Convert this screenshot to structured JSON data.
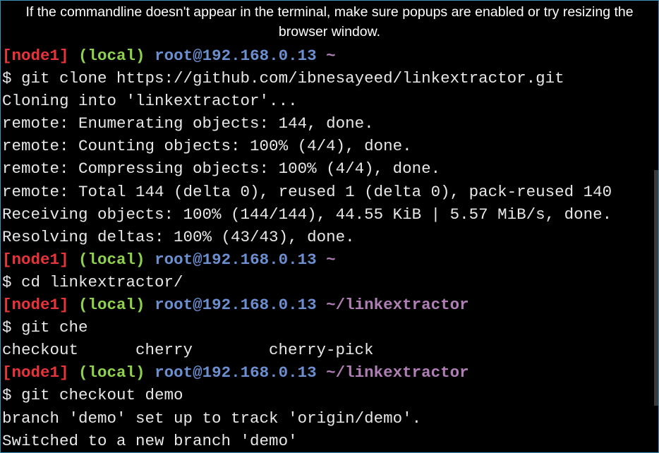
{
  "notice": "If the commandline doesn't appear in the terminal, make sure popups are enabled or try resizing the browser window.",
  "prompt": {
    "node": "[node1]",
    "env": "(local)",
    "host": "root@192.168.0.13"
  },
  "lines": {
    "p1_path": "~",
    "cmd1": "$ git clone https://github.com/ibnesayeed/linkextractor.git",
    "out1": "Cloning into 'linkextractor'...",
    "out2": "remote: Enumerating objects: 144, done.",
    "out3": "remote: Counting objects: 100% (4/4), done.",
    "out4": "remote: Compressing objects: 100% (4/4), done.",
    "out5": "remote: Total 144 (delta 0), reused 1 (delta 0), pack-reused 140",
    "out6": "Receiving objects: 100% (144/144), 44.55 KiB | 5.57 MiB/s, done.",
    "out7": "Resolving deltas: 100% (43/43), done.",
    "p2_path": "~",
    "cmd2": "$ cd linkextractor/",
    "p3_path": "~/linkextractor",
    "cmd3": "$ git che",
    "completions": [
      "checkout",
      "cherry",
      "cherry-pick"
    ],
    "p4_path": "~/linkextractor",
    "cmd4": "$ git checkout demo",
    "out8": "branch 'demo' set up to track 'origin/demo'.",
    "out9": "Switched to a new branch 'demo'"
  },
  "colors": {
    "node": "#e8343a",
    "env": "#8fd14f",
    "host": "#6b8fcf",
    "path": "#b07fb6",
    "text": "#e8e8e8",
    "background": "#000000"
  }
}
